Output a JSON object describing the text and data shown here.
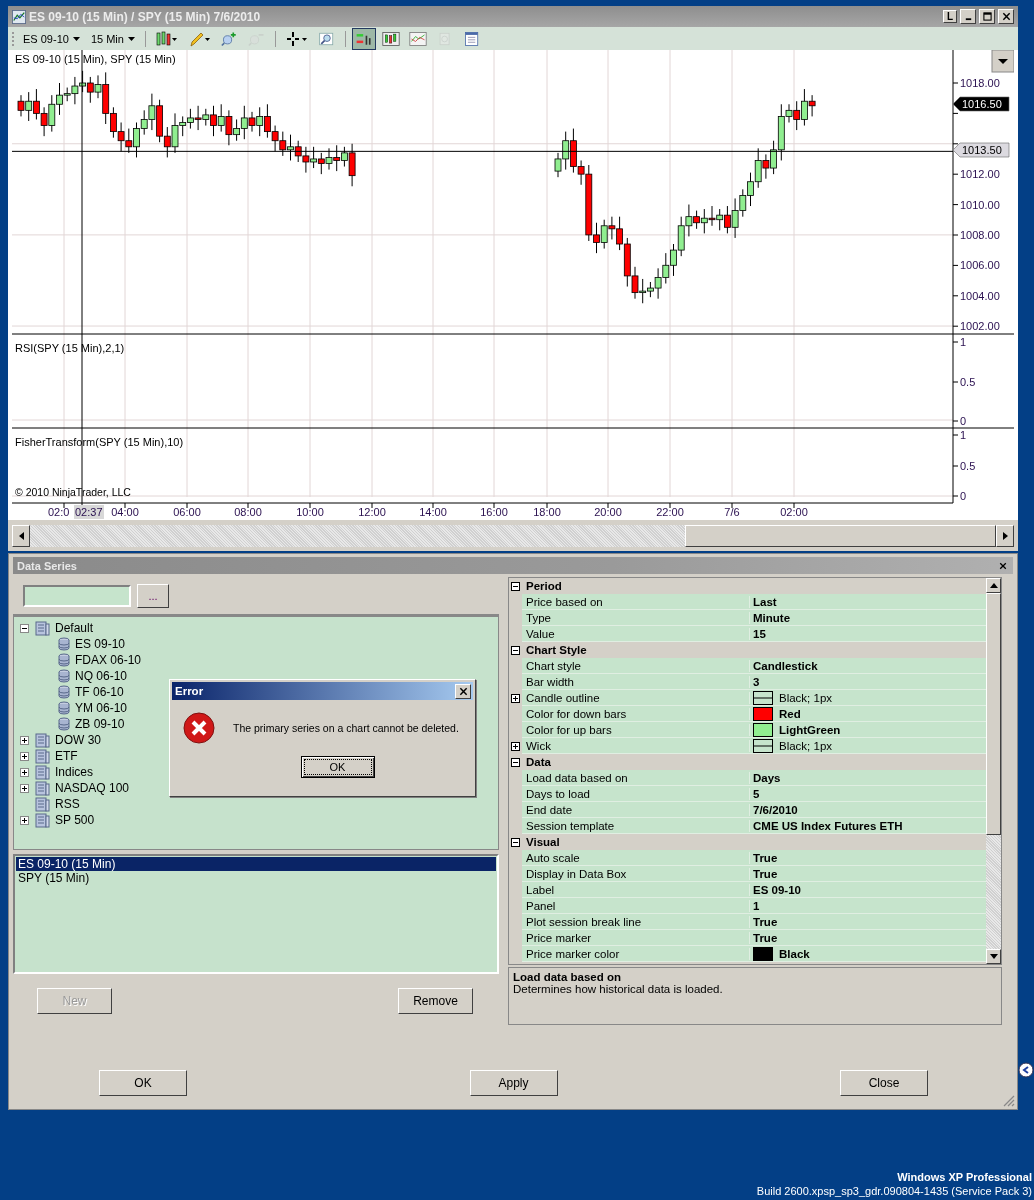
{
  "chart_window": {
    "title": "ES 09-10 (15 Min) / SPY (15 Min)  7/6/2010",
    "link_button": "L",
    "toolbar": {
      "instrument": "ES 09-10",
      "interval": "15 Min",
      "tools": [
        {
          "selected": false,
          "disabled": false
        },
        {
          "selected": false,
          "disabled": false
        },
        {
          "selected": false,
          "disabled": false
        },
        {
          "selected": false,
          "disabled": true
        },
        {
          "selected": false,
          "disabled": false
        },
        {
          "selected": false,
          "disabled": false
        },
        {
          "selected": true,
          "disabled": false
        },
        {
          "selected": false,
          "disabled": false
        },
        {
          "selected": false,
          "disabled": false
        },
        {
          "selected": false,
          "disabled": true
        },
        {
          "selected": false,
          "disabled": false
        }
      ]
    },
    "chart": {
      "panels": [
        {
          "title": "ES 09-10 (15 Min), SPY (15 Min)",
          "axis_labels": [
            "1018.00",
            "1012.00",
            "1010.00",
            "1008.00",
            "1006.00",
            "1004.00",
            "1002.00"
          ]
        },
        {
          "title": "RSI(SPY (15 Min),2,1)",
          "axis_labels": [
            "1",
            "0.5",
            "0"
          ]
        },
        {
          "title": "FisherTransform(SPY (15 Min),10)",
          "axis_labels": [
            "1",
            "0.5",
            "0"
          ]
        }
      ],
      "price_markers": [
        {
          "text": "1016.50",
          "kind": "last"
        },
        {
          "text": "1013.50",
          "kind": "cursor"
        }
      ],
      "time_labels": [
        "02:0",
        "04:00",
        "06:00",
        "08:00",
        "10:00",
        "12:00",
        "14:00",
        "16:00",
        "18:00",
        "20:00",
        "22:00",
        "7/6",
        "02:00"
      ],
      "cursor_time": "02:37",
      "copyright": "© 2010 NinjaTrader, LLC"
    }
  },
  "data_series": {
    "title": "Data Series",
    "browse_button": "...",
    "tree": [
      {
        "label": "Default",
        "kind": "folder",
        "expanded": true,
        "children": [
          {
            "label": "ES 09-10"
          },
          {
            "label": "FDAX 06-10"
          },
          {
            "label": "NQ 06-10"
          },
          {
            "label": "TF 06-10"
          },
          {
            "label": "YM 06-10"
          },
          {
            "label": "ZB 09-10"
          }
        ]
      },
      {
        "label": "DOW 30",
        "kind": "folder",
        "expanded": false
      },
      {
        "label": "ETF",
        "kind": "folder",
        "expanded": false
      },
      {
        "label": "Indices",
        "kind": "folder",
        "expanded": false
      },
      {
        "label": "NASDAQ 100",
        "kind": "folder",
        "expanded": false
      },
      {
        "label": "RSS",
        "kind": "empty"
      },
      {
        "label": "SP 500",
        "kind": "folder",
        "expanded": false
      }
    ],
    "series_list": [
      {
        "label": "ES 09-10 (15 Min)",
        "selected": true
      },
      {
        "label": "SPY (15 Min)",
        "selected": false
      }
    ],
    "new_button": {
      "label": "New",
      "disabled": true
    },
    "remove_button": {
      "label": "Remove",
      "disabled": false
    },
    "properties": [
      {
        "category": "Period",
        "expanded": true,
        "rows": [
          {
            "name": "Price based on",
            "value": "Last",
            "kind": "text"
          },
          {
            "name": "Type",
            "value": "Minute",
            "kind": "text"
          },
          {
            "name": "Value",
            "value": "15",
            "kind": "text"
          }
        ]
      },
      {
        "category": "Chart Style",
        "expanded": true,
        "rows": [
          {
            "name": "Chart style",
            "value": "Candlestick",
            "kind": "text"
          },
          {
            "name": "Bar width",
            "value": "3",
            "kind": "text"
          },
          {
            "name": "Candle outline",
            "value": "Black; 1px",
            "kind": "line",
            "expanded": false
          },
          {
            "name": "Color for down bars",
            "value": "Red",
            "kind": "color",
            "color": "#ff0000"
          },
          {
            "name": "Color for up bars",
            "value": "LightGreen",
            "kind": "color",
            "color": "#90ee90"
          },
          {
            "name": "Wick",
            "value": "Black; 1px",
            "kind": "line",
            "expanded": false
          }
        ]
      },
      {
        "category": "Data",
        "expanded": true,
        "rows": [
          {
            "name": "Load data based on",
            "value": "Days",
            "kind": "text"
          },
          {
            "name": "Days to load",
            "value": "5",
            "kind": "text"
          },
          {
            "name": "End date",
            "value": "7/6/2010",
            "kind": "text"
          },
          {
            "name": "Session template",
            "value": "CME US Index Futures ETH",
            "kind": "text"
          }
        ]
      },
      {
        "category": "Visual",
        "expanded": true,
        "rows": [
          {
            "name": "Auto scale",
            "value": "True",
            "kind": "text"
          },
          {
            "name": "Display in Data Box",
            "value": "True",
            "kind": "text"
          },
          {
            "name": "Label",
            "value": "ES 09-10",
            "kind": "text"
          },
          {
            "name": "Panel",
            "value": "1",
            "kind": "text"
          },
          {
            "name": "Plot session break line",
            "value": "True",
            "kind": "text"
          },
          {
            "name": "Price marker",
            "value": "True",
            "kind": "text"
          },
          {
            "name": "Price marker color",
            "value": "Black",
            "kind": "color",
            "color": "#000000"
          }
        ]
      }
    ],
    "description": {
      "title": "Load data based on",
      "text": "Determines how historical data is loaded."
    },
    "buttons": [
      "OK",
      "Apply",
      "Close"
    ]
  },
  "error_dialog": {
    "title": "Error",
    "message": "The primary series on a chart cannot be deleted.",
    "button": "OK"
  },
  "os_info": [
    "Windows XP Professional",
    "Build 2600.xpsp_sp3_gdr.090804-1435 (Service Pack 3)"
  ]
}
